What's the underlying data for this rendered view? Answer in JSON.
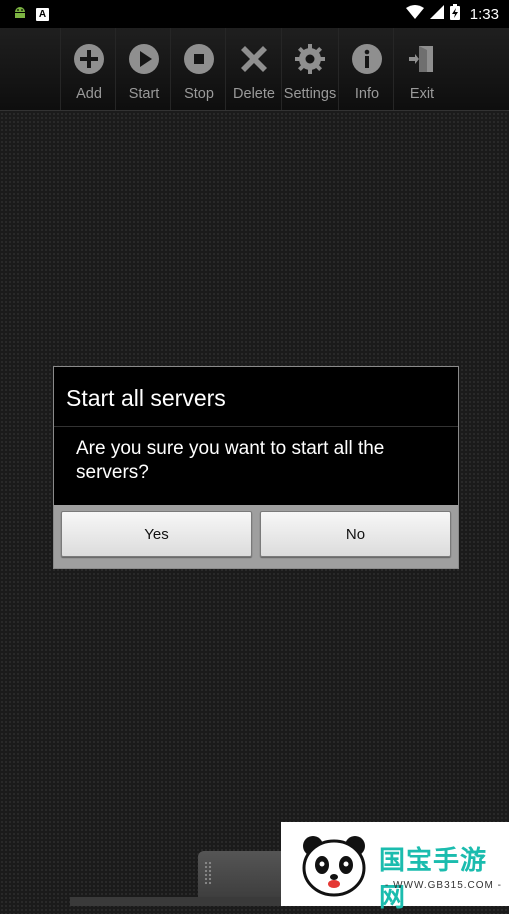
{
  "status_bar": {
    "time": "1:33",
    "left_icons": [
      "android-icon",
      "a-box-icon"
    ],
    "right_icons": [
      "wifi-icon",
      "signal-icon",
      "battery-charging-icon"
    ]
  },
  "toolbar": {
    "items": [
      {
        "label": "Add",
        "icon": "add-icon"
      },
      {
        "label": "Start",
        "icon": "play-icon"
      },
      {
        "label": "Stop",
        "icon": "stop-icon"
      },
      {
        "label": "Delete",
        "icon": "delete-icon"
      },
      {
        "label": "Settings",
        "icon": "gear-icon"
      },
      {
        "label": "Info",
        "icon": "info-icon"
      },
      {
        "label": "Exit",
        "icon": "exit-icon"
      }
    ]
  },
  "dialog": {
    "title": "Start all servers",
    "message": "Are you sure you want to start all the servers?",
    "yes_label": "Yes",
    "no_label": "No"
  },
  "watermark": {
    "text": "国宝手游网",
    "sub": "- WWW.GB315.COM -"
  },
  "colors": {
    "background": "#1b1b1b",
    "toolbar_icon": "#8f8f8f",
    "toolbar_label": "#9a9a9a",
    "dialog_button_bar": "#9f9f9f"
  }
}
